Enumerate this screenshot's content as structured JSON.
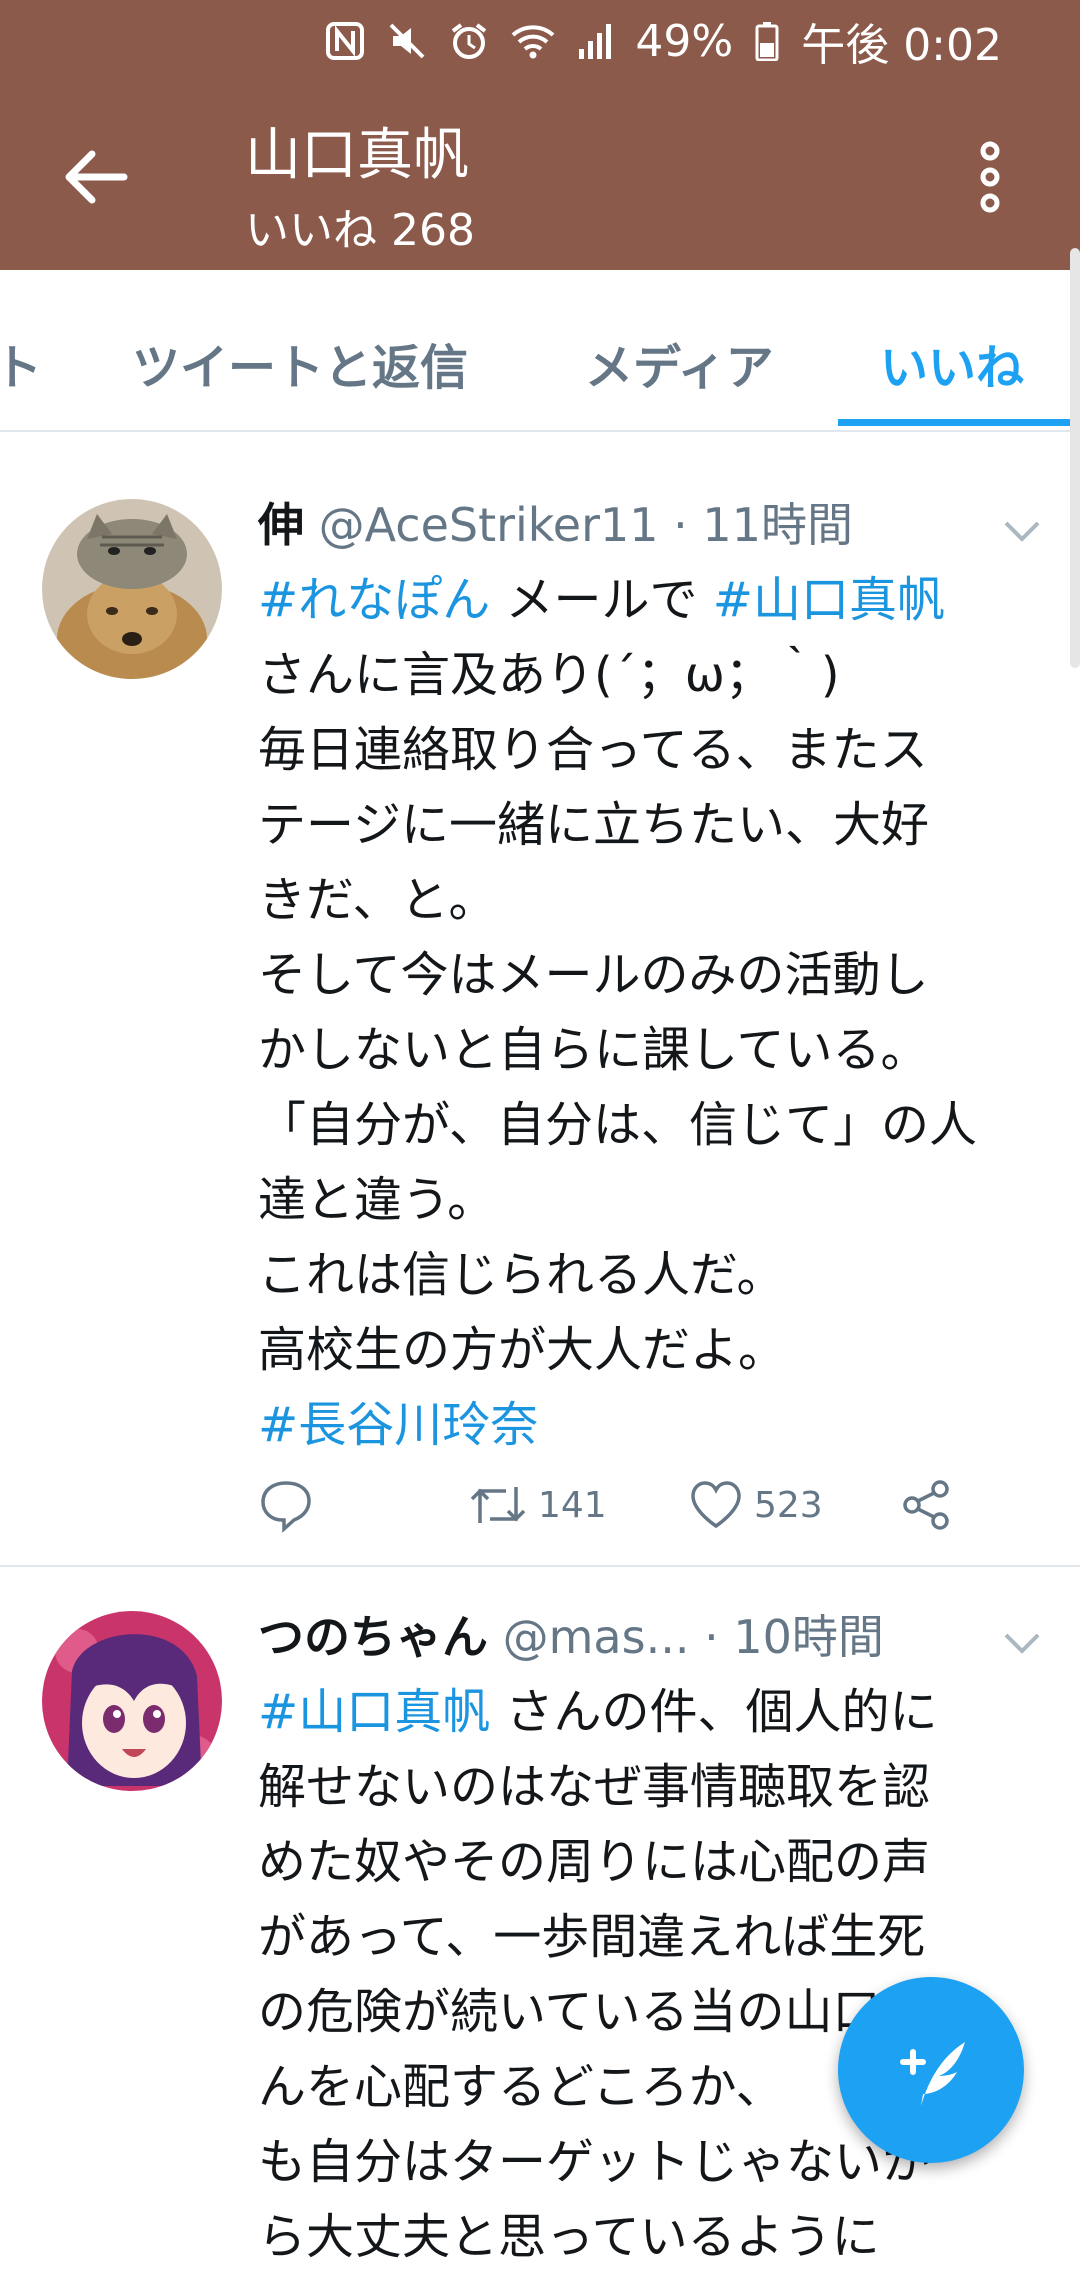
{
  "status_bar": {
    "icons": [
      "nfc-icon",
      "mute-icon",
      "alarm-icon",
      "wifi-icon",
      "signal-icon",
      "battery-icon"
    ],
    "battery": "49%",
    "time": "午後 0:02"
  },
  "header": {
    "title": "山口真帆",
    "subtitle": "いいね 268"
  },
  "tabs": [
    {
      "label": "ト"
    },
    {
      "label": "ツイートと返信"
    },
    {
      "label": "メディア"
    },
    {
      "label": "いいね",
      "active": true
    }
  ],
  "tweets": [
    {
      "display_name": "伸",
      "handle": "@AceStriker11",
      "time": " · 11時間",
      "lines": [
        [
          {
            "t": "#れなぽん",
            "h": true
          },
          {
            "t": " メールで "
          },
          {
            "t": "#山口真帆",
            "h": true
          }
        ],
        [
          {
            "t": "さんに言及あり(´；ω；｀)"
          }
        ],
        [
          {
            "t": "毎日連絡取り合ってる、またス"
          }
        ],
        [
          {
            "t": "テージに一緒に立ちたい、大好"
          }
        ],
        [
          {
            "t": "きだ、と。"
          }
        ],
        [
          {
            "t": "そして今はメールのみの活動し"
          }
        ],
        [
          {
            "t": "かしないと自らに課している。"
          }
        ],
        [
          {
            "t": "「自分が、自分は、信じて」の人"
          }
        ],
        [
          {
            "t": "達と違う。"
          }
        ],
        [
          {
            "t": "これは信じられる人だ。"
          }
        ],
        [
          {
            "t": "高校生の方が大人だよ。"
          }
        ],
        [
          {
            "t": "#長谷川玲奈",
            "h": true
          }
        ]
      ],
      "retweets": "141",
      "likes": "523"
    },
    {
      "display_name": "つのちゃん",
      "handle": "@mas...",
      "time": " · 10時間",
      "lines": [
        [
          {
            "t": "#山口真帆",
            "h": true
          },
          {
            "t": " さんの件、個人的に"
          }
        ],
        [
          {
            "t": "解せないのはなぜ事情聴取を認"
          }
        ],
        [
          {
            "t": "めた奴やその周りには心配の声"
          }
        ],
        [
          {
            "t": "があって、一歩間違えれば生死"
          }
        ],
        [
          {
            "t": "の危険が続いている当の山口さ"
          }
        ],
        [
          {
            "t": "んを心配するどころか、"
          }
        ],
        [
          {
            "t": "も自分はターゲットじゃないか"
          }
        ],
        [
          {
            "t": "ら大丈夫と思っているように"
          }
        ]
      ]
    }
  ],
  "colors": {
    "header_bg": "#8b5a4b",
    "accent": "#1da1f2",
    "hashtag": "#1b95e0",
    "secondary_text": "#657786"
  }
}
